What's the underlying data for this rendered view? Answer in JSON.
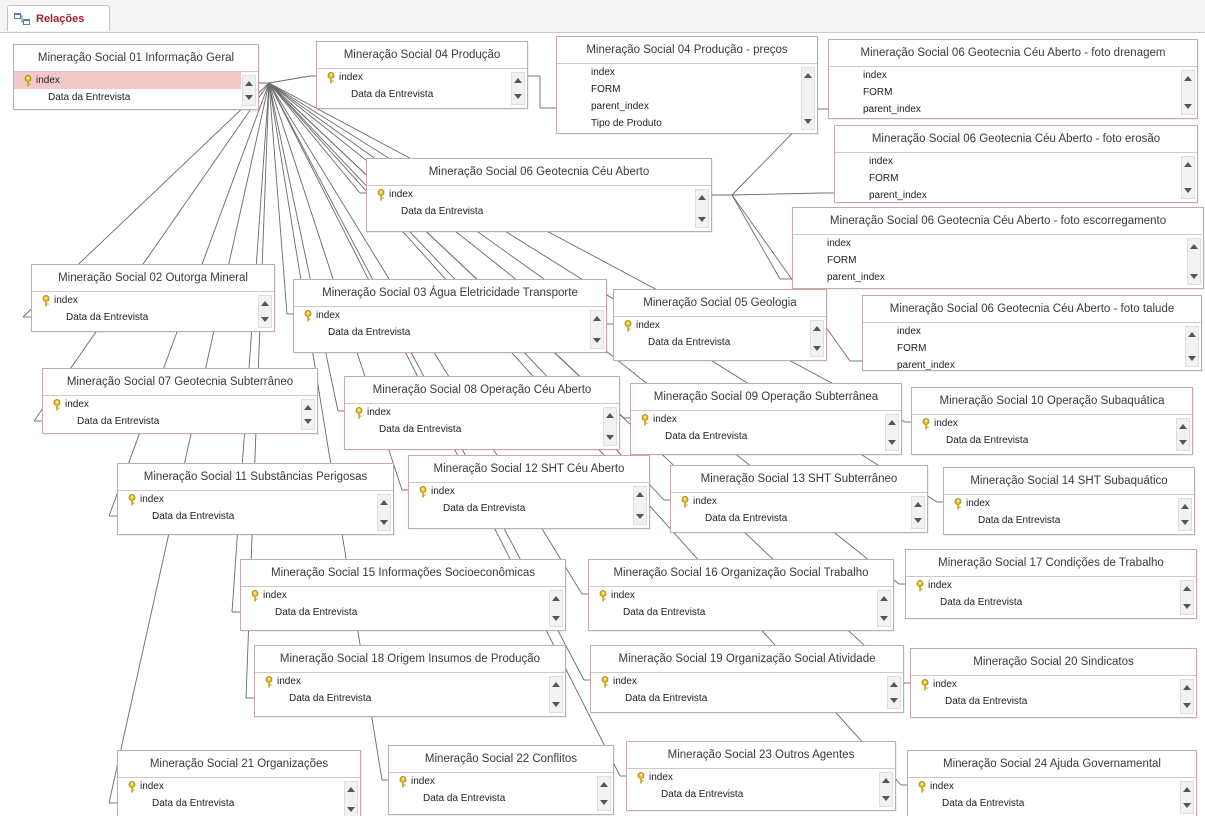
{
  "tab": {
    "label": "Relações",
    "icon": "relationships-icon"
  },
  "selected_field": {
    "table": "t01",
    "field": "index"
  },
  "tables": [
    {
      "id": "t01",
      "title": "Mineração Social 01 Informação Geral",
      "fields": [
        {
          "name": "index",
          "pk": true
        },
        {
          "name": "Data da Entrevista",
          "pk": false
        }
      ]
    },
    {
      "id": "t04",
      "title": "Mineração Social 04 Produção",
      "fields": [
        {
          "name": "index",
          "pk": true
        },
        {
          "name": "Data da Entrevista",
          "pk": false
        }
      ]
    },
    {
      "id": "t04p",
      "title": "Mineração Social 04 Produção - preços",
      "fields": [
        {
          "name": "index",
          "pk": false
        },
        {
          "name": "FORM",
          "pk": false
        },
        {
          "name": "parent_index",
          "pk": false
        },
        {
          "name": "Tipo de Produto",
          "pk": false
        }
      ]
    },
    {
      "id": "t06d",
      "title": "Mineração Social 06 Geotecnia Céu Aberto - foto drenagem",
      "fields": [
        {
          "name": "index",
          "pk": false
        },
        {
          "name": "FORM",
          "pk": false
        },
        {
          "name": "parent_index",
          "pk": false
        }
      ]
    },
    {
      "id": "t06er",
      "title": "Mineração Social 06 Geotecnia Céu Aberto - foto erosão",
      "fields": [
        {
          "name": "index",
          "pk": false
        },
        {
          "name": "FORM",
          "pk": false
        },
        {
          "name": "parent_index",
          "pk": false
        }
      ]
    },
    {
      "id": "t06",
      "title": "Mineração Social 06 Geotecnia Céu Aberto",
      "fields": [
        {
          "name": "index",
          "pk": true
        },
        {
          "name": "Data da Entrevista",
          "pk": false
        }
      ]
    },
    {
      "id": "t06es",
      "title": "Mineração Social 06 Geotecnia Céu Aberto - foto escorregamento",
      "fields": [
        {
          "name": "index",
          "pk": false
        },
        {
          "name": "FORM",
          "pk": false
        },
        {
          "name": "parent_index",
          "pk": false
        }
      ]
    },
    {
      "id": "t02",
      "title": "Mineração Social 02 Outorga Mineral",
      "fields": [
        {
          "name": "index",
          "pk": true
        },
        {
          "name": "Data da Entrevista",
          "pk": false
        }
      ]
    },
    {
      "id": "t03",
      "title": "Mineração Social 03 Água Eletricidade Transporte",
      "fields": [
        {
          "name": "index",
          "pk": true
        },
        {
          "name": "Data da Entrevista",
          "pk": false
        }
      ]
    },
    {
      "id": "t05",
      "title": "Mineração Social 05 Geologia",
      "fields": [
        {
          "name": "index",
          "pk": true
        },
        {
          "name": "Data da Entrevista",
          "pk": false
        }
      ]
    },
    {
      "id": "t06t",
      "title": "Mineração Social 06 Geotecnia Céu Aberto - foto talude",
      "fields": [
        {
          "name": "index",
          "pk": false
        },
        {
          "name": "FORM",
          "pk": false
        },
        {
          "name": "parent_index",
          "pk": false
        }
      ]
    },
    {
      "id": "t07",
      "title": "Mineração Social 07 Geotecnia Subterrâneo",
      "fields": [
        {
          "name": "index",
          "pk": true
        },
        {
          "name": "Data da Entrevista",
          "pk": false
        }
      ]
    },
    {
      "id": "t08",
      "title": "Mineração Social 08 Operação Céu Aberto",
      "fields": [
        {
          "name": "index",
          "pk": true
        },
        {
          "name": "Data da Entrevista",
          "pk": false
        }
      ]
    },
    {
      "id": "t09",
      "title": "Mineração Social 09 Operação Subterrânea",
      "fields": [
        {
          "name": "index",
          "pk": true
        },
        {
          "name": "Data da Entrevista",
          "pk": false
        }
      ]
    },
    {
      "id": "t10",
      "title": "Mineração Social 10 Operação Subaquática",
      "fields": [
        {
          "name": "index",
          "pk": true
        },
        {
          "name": "Data da Entrevista",
          "pk": false
        }
      ]
    },
    {
      "id": "t11",
      "title": "Mineração Social 11 Substâncias Perigosas",
      "fields": [
        {
          "name": "index",
          "pk": true
        },
        {
          "name": "Data da Entrevista",
          "pk": false
        }
      ]
    },
    {
      "id": "t12",
      "title": "Mineração Social 12 SHT Céu Aberto",
      "fields": [
        {
          "name": "index",
          "pk": true
        },
        {
          "name": "Data da Entrevista",
          "pk": false
        }
      ]
    },
    {
      "id": "t13",
      "title": "Mineração Social 13 SHT Subterrâneo",
      "fields": [
        {
          "name": "index",
          "pk": true
        },
        {
          "name": "Data da Entrevista",
          "pk": false
        }
      ]
    },
    {
      "id": "t14",
      "title": "Mineração Social 14 SHT Subaquático",
      "fields": [
        {
          "name": "index",
          "pk": true
        },
        {
          "name": "Data da Entrevista",
          "pk": false
        }
      ]
    },
    {
      "id": "t15",
      "title": "Mineração Social 15 Informações Socioeconômicas",
      "fields": [
        {
          "name": "index",
          "pk": true
        },
        {
          "name": "Data da Entrevista",
          "pk": false
        }
      ]
    },
    {
      "id": "t16",
      "title": "Mineração Social 16 Organização Social Trabalho",
      "fields": [
        {
          "name": "index",
          "pk": true
        },
        {
          "name": "Data da Entrevista",
          "pk": false
        }
      ]
    },
    {
      "id": "t17",
      "title": "Mineração Social 17 Condições de Trabalho",
      "fields": [
        {
          "name": "index",
          "pk": true
        },
        {
          "name": "Data da Entrevista",
          "pk": false
        }
      ]
    },
    {
      "id": "t18",
      "title": "Mineração Social 18 Origem Insumos de Produção",
      "fields": [
        {
          "name": "index",
          "pk": true
        },
        {
          "name": "Data da Entrevista",
          "pk": false
        }
      ]
    },
    {
      "id": "t19",
      "title": "Mineração Social 19 Organização Social Atividade",
      "fields": [
        {
          "name": "index",
          "pk": true
        },
        {
          "name": "Data da Entrevista",
          "pk": false
        }
      ]
    },
    {
      "id": "t20",
      "title": "Mineração Social 20 Sindicatos",
      "fields": [
        {
          "name": "index",
          "pk": true
        },
        {
          "name": "Data da Entrevista",
          "pk": false
        }
      ]
    },
    {
      "id": "t21",
      "title": "Mineração Social 21 Organizações",
      "fields": [
        {
          "name": "index",
          "pk": true
        },
        {
          "name": "Data da Entrevista",
          "pk": false
        }
      ]
    },
    {
      "id": "t22",
      "title": "Mineração Social 22 Conflitos",
      "fields": [
        {
          "name": "index",
          "pk": true
        },
        {
          "name": "Data da Entrevista",
          "pk": false
        }
      ]
    },
    {
      "id": "t23",
      "title": "Mineração Social 23 Outros Agentes",
      "fields": [
        {
          "name": "index",
          "pk": true
        },
        {
          "name": "Data da Entrevista",
          "pk": false
        }
      ]
    },
    {
      "id": "t24",
      "title": "Mineração Social 24 Ajuda Governamental",
      "fields": [
        {
          "name": "index",
          "pk": true
        },
        {
          "name": "Data da Entrevista",
          "pk": false
        }
      ]
    }
  ],
  "relationships": [
    [
      "t01",
      "t04"
    ],
    [
      "t01",
      "t06"
    ],
    [
      "t01",
      "t02"
    ],
    [
      "t01",
      "t03"
    ],
    [
      "t01",
      "t05"
    ],
    [
      "t01",
      "t07"
    ],
    [
      "t01",
      "t08"
    ],
    [
      "t01",
      "t09"
    ],
    [
      "t01",
      "t10"
    ],
    [
      "t01",
      "t11"
    ],
    [
      "t01",
      "t12"
    ],
    [
      "t01",
      "t13"
    ],
    [
      "t01",
      "t14"
    ],
    [
      "t01",
      "t15"
    ],
    [
      "t01",
      "t16"
    ],
    [
      "t01",
      "t17"
    ],
    [
      "t01",
      "t18"
    ],
    [
      "t01",
      "t19"
    ],
    [
      "t01",
      "t20"
    ],
    [
      "t01",
      "t21"
    ],
    [
      "t01",
      "t22"
    ],
    [
      "t01",
      "t23"
    ],
    [
      "t01",
      "t24"
    ],
    [
      "t04",
      "t04p"
    ],
    [
      "t06",
      "t06d"
    ],
    [
      "t06",
      "t06er"
    ],
    [
      "t06",
      "t06es"
    ],
    [
      "t06",
      "t06t"
    ]
  ]
}
